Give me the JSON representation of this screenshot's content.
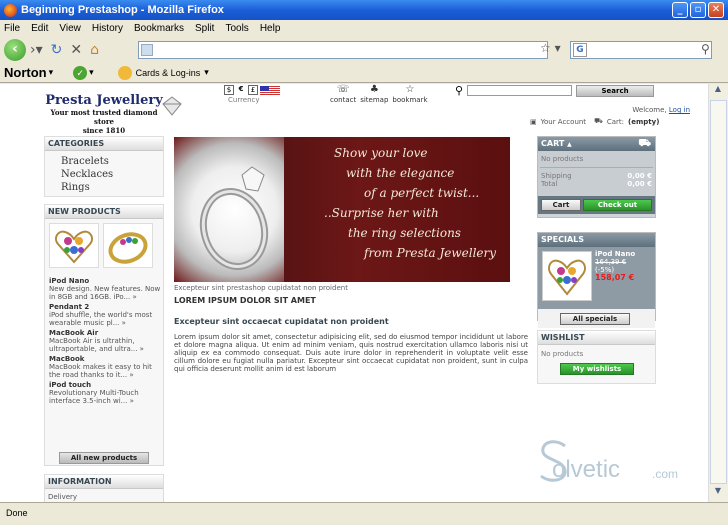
{
  "browser": {
    "title": "Beginning Prestashop - Mozilla Firefox",
    "menu": [
      "File",
      "Edit",
      "View",
      "History",
      "Bookmarks",
      "Split",
      "Tools",
      "Help"
    ],
    "norton": "Norton",
    "cards_label": "Cards & Log-ins",
    "status": "Done"
  },
  "shop": {
    "logo": {
      "name": "Presta Jewellery",
      "tagline": "Your most trusted diamond store",
      "since": "since 1810"
    },
    "currency_label": "Currency",
    "currency_symbols": [
      "$",
      "€",
      "£"
    ],
    "nav": {
      "contact": "contact",
      "sitemap": "sitemap",
      "bookmark": "bookmark"
    },
    "search_button": "Search",
    "welcome": "Welcome,",
    "login": "Log in",
    "your_account": "Your Account",
    "cart_label": "Cart:",
    "cart_state": "(empty)"
  },
  "categories": {
    "title": "CATEGORIES",
    "items": [
      "Bracelets",
      "Necklaces",
      "Rings"
    ]
  },
  "new_products": {
    "title": "NEW PRODUCTS",
    "items": [
      {
        "name": "iPod Nano",
        "desc": "New design. New features. Now in 8GB and 16GB. iPo... »"
      },
      {
        "name": "Pendant 2",
        "desc": "iPod shuffle, the world's most wearable music pl... »"
      },
      {
        "name": "MacBook Air",
        "desc": "MacBook Air is ultrathin, ultraportable, and ultra... »"
      },
      {
        "name": "MacBook",
        "desc": "MacBook makes it easy to hit the road thanks to it... »"
      },
      {
        "name": "iPod touch",
        "desc": "Revolutionary Multi-Touch interface 3.5-inch wi... »"
      }
    ],
    "all_button": "All new products"
  },
  "information": {
    "title": "INFORMATION",
    "first": "Delivery"
  },
  "banner": {
    "lines": [
      "Show your love",
      "with the elegance",
      "of a perfect twist...",
      "..Surprise her with",
      "the ring selections",
      "from Presta Jewellery"
    ],
    "caption": "Excepteur sint prestashop cupidatat non proident"
  },
  "content": {
    "heading1": "LOREM IPSUM DOLOR SIT AMET",
    "heading2": "Excepteur sint occaecat cupidatat non proident",
    "body": "Lorem ipsum dolor sit amet, consectetur adipisicing elit, sed do eiusmod tempor incididunt ut labore et dolore magna aliqua. Ut enim ad minim veniam, quis nostrud exercitation ullamco laboris nisi ut aliquip ex ea commodo consequat. Duis aute irure dolor in reprehenderit in voluptate velit esse cillum dolore eu fugiat nulla pariatur. Excepteur sint occaecat cupidatat non proident, sunt in culpa qui officia deserunt mollit anim id est laborum"
  },
  "cart": {
    "title": "CART",
    "toggle": "▲",
    "no_products": "No products",
    "shipping_label": "Shipping",
    "shipping_value": "0,00 €",
    "total_label": "Total",
    "total_value": "0,00 €",
    "cart_button": "Cart",
    "checkout_button": "Check out"
  },
  "specials": {
    "title": "SPECIALS",
    "product": "iPod Nano",
    "old_price": "164,39 €",
    "discount": "(-5%)",
    "new_price": "158,07 €",
    "all_button": "All specials"
  },
  "wishlist": {
    "title": "WISHLIST",
    "no_products": "No products",
    "button": "My wishlists"
  },
  "watermark": {
    "text": "olvetic",
    "suffix": ".com"
  },
  "colors": {
    "accent_green": "#2a922a",
    "dark_header": "#5e6f7c",
    "banner_red": "#6d1717"
  }
}
